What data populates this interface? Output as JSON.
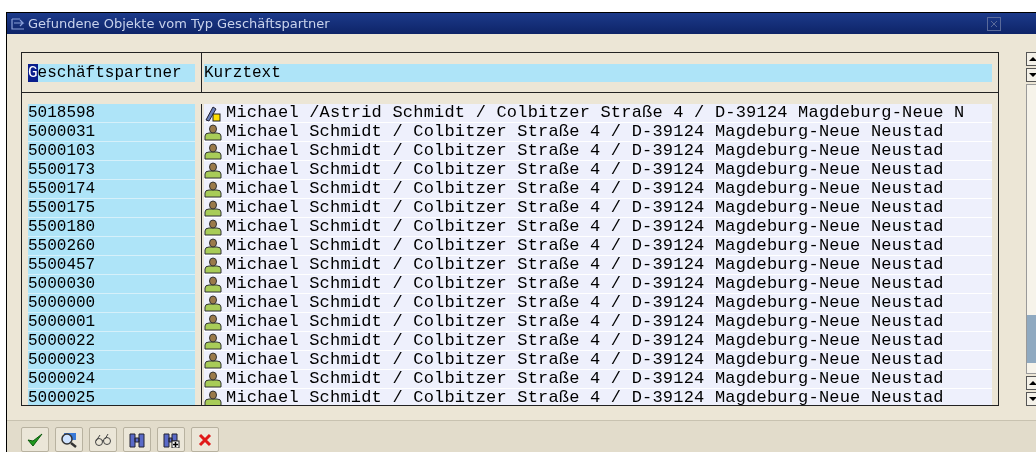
{
  "window": {
    "title": "Gefundene Objekte vom Typ Geschäftspartner"
  },
  "table": {
    "columns": [
      {
        "label": "Geschäftspartner",
        "focused": true
      },
      {
        "label": "Kurztext",
        "focused": false
      }
    ],
    "rows": [
      {
        "id": "5018598",
        "kind": "group",
        "text": "Michael /Astrid Schmidt / Colbitzer Straße 4 / D-39124 Magdeburg-Neue N"
      },
      {
        "id": "5000031",
        "kind": "person",
        "text": "Michael Schmidt / Colbitzer Straße 4 / D-39124 Magdeburg-Neue Neustad"
      },
      {
        "id": "5000103",
        "kind": "person",
        "text": "Michael Schmidt / Colbitzer Straße 4 / D-39124 Magdeburg-Neue Neustad"
      },
      {
        "id": "5500173",
        "kind": "person",
        "text": "Michael Schmidt / Colbitzer Straße 4 / D-39124 Magdeburg-Neue Neustad"
      },
      {
        "id": "5500174",
        "kind": "person",
        "text": "Michael Schmidt / Colbitzer Straße 4 / D-39124 Magdeburg-Neue Neustad"
      },
      {
        "id": "5500175",
        "kind": "person",
        "text": "Michael Schmidt / Colbitzer Straße 4 / D-39124 Magdeburg-Neue Neustad"
      },
      {
        "id": "5500180",
        "kind": "person",
        "text": "Michael Schmidt / Colbitzer Straße 4 / D-39124 Magdeburg-Neue Neustad"
      },
      {
        "id": "5500260",
        "kind": "person",
        "text": "Michael Schmidt / Colbitzer Straße 4 / D-39124 Magdeburg-Neue Neustad"
      },
      {
        "id": "5500457",
        "kind": "person",
        "text": "Michael Schmidt / Colbitzer Straße 4 / D-39124 Magdeburg-Neue Neustad"
      },
      {
        "id": "5000030",
        "kind": "person",
        "text": "Michael Schmidt / Colbitzer Straße 4 / D-39124 Magdeburg-Neue Neustad"
      },
      {
        "id": "5000000",
        "kind": "person",
        "text": "Michael Schmidt / Colbitzer Straße 4 / D-39124 Magdeburg-Neue Neustad"
      },
      {
        "id": "5000001",
        "kind": "person",
        "text": "Michael Schmidt / Colbitzer Straße 4 / D-39124 Magdeburg-Neue Neustad"
      },
      {
        "id": "5000022",
        "kind": "person",
        "text": "Michael Schmidt / Colbitzer Straße 4 / D-39124 Magdeburg-Neue Neustad"
      },
      {
        "id": "5000023",
        "kind": "person",
        "text": "Michael Schmidt / Colbitzer Straße 4 / D-39124 Magdeburg-Neue Neustad"
      },
      {
        "id": "5000024",
        "kind": "person",
        "text": "Michael Schmidt / Colbitzer Straße 4 / D-39124 Magdeburg-Neue Neustad"
      },
      {
        "id": "5000025",
        "kind": "person",
        "text": "Michael Schmidt / Colbitzer Straße 4 / D-39124 Magdeburg-Neue Neustad"
      }
    ]
  },
  "toolbar": [
    {
      "kind": "confirm"
    },
    {
      "kind": "magnifier"
    },
    {
      "kind": "glasses"
    },
    {
      "kind": "binoculars"
    },
    {
      "kind": "binoculars-plus"
    },
    {
      "kind": "cancel"
    }
  ]
}
